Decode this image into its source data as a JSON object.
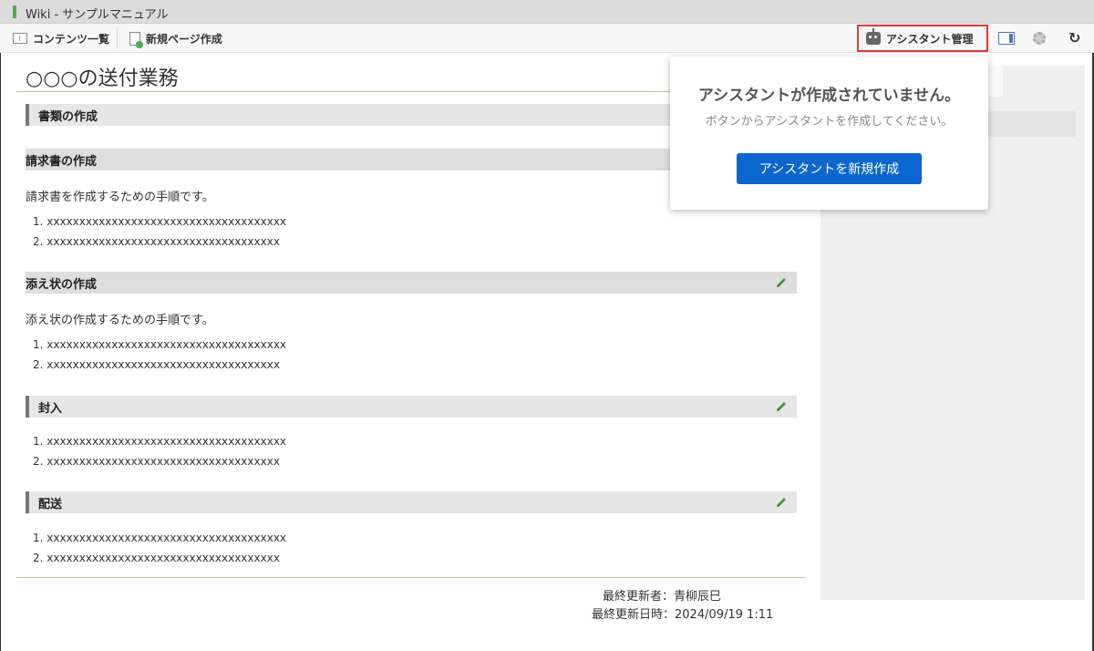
{
  "window": {
    "title": "Wiki - サンプルマニュアル"
  },
  "toolbar": {
    "contents_list_label": "コンテンツ一覧",
    "new_page_label": "新規ページ作成",
    "assistant_manage_label": "アシスタント管理"
  },
  "page": {
    "title": "○○○の送付業務",
    "sections": [
      {
        "label": "書類の作成"
      },
      {
        "label": "請求書の作成",
        "description": "請求書を作成するための手順です。",
        "items": [
          "1. xxxxxxxxxxxxxxxxxxxxxxxxxxxxxxxxxxxxx",
          "2. xxxxxxxxxxxxxxxxxxxxxxxxxxxxxxxxxxxx"
        ]
      },
      {
        "label": "添え状の作成",
        "description": "添え状の作成するための手順です。",
        "items": [
          "1. xxxxxxxxxxxxxxxxxxxxxxxxxxxxxxxxxxxxx",
          "2. xxxxxxxxxxxxxxxxxxxxxxxxxxxxxxxxxxxx"
        ]
      },
      {
        "label": "封入",
        "items": [
          "1. xxxxxxxxxxxxxxxxxxxxxxxxxxxxxxxxxxxxx",
          "2. xxxxxxxxxxxxxxxxxxxxxxxxxxxxxxxxxxxx"
        ]
      },
      {
        "label": "配送",
        "items": [
          "1. xxxxxxxxxxxxxxxxxxxxxxxxxxxxxxxxxxxxx",
          "2. xxxxxxxxxxxxxxxxxxxxxxxxxxxxxxxxxxxx"
        ]
      }
    ],
    "last_updated_by": "最終更新者：青柳辰巳",
    "last_updated_at": "最終更新日時：2024/09/19 1:11"
  },
  "popup": {
    "heading": "アシスタントが作成されていません。",
    "subtext": "ボタンからアシスタントを作成してください。",
    "create_button_label": "アシスタントを新規作成"
  },
  "colors": {
    "accent_green": "#4caf50",
    "primary_blue": "#0b66d0",
    "highlight_red": "#e53935"
  },
  "icons": [
    "list-icon",
    "new-page-icon",
    "robot-icon",
    "panel-icon",
    "gear-icon",
    "refresh-icon",
    "pencil-icon"
  ]
}
